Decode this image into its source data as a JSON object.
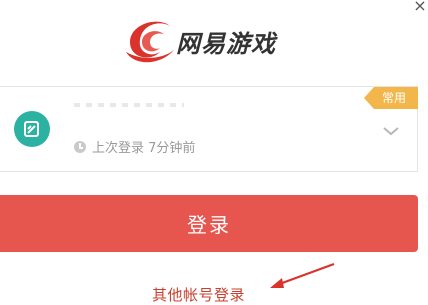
{
  "window": {
    "close_label": "×"
  },
  "brand": {
    "name": "网易游戏",
    "logo_icon": "netease-swirl-icon",
    "accent": "#d9332b"
  },
  "account": {
    "masked_id": "",
    "last_login": "上次登录 7分钟前",
    "badge": "常用",
    "avatar_icon": "account-avatar-icon"
  },
  "actions": {
    "login_label": "登录",
    "other_login_label": "其他帐号登录"
  },
  "colors": {
    "primary": "#e7554f",
    "badge": "#f2b64a",
    "link": "#c9412f"
  }
}
